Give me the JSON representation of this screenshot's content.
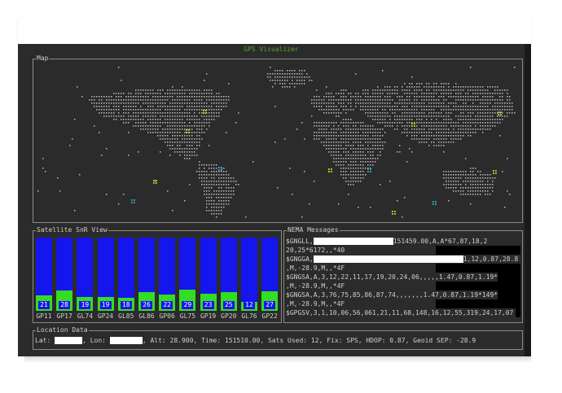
{
  "app": {
    "title": "GPS Visualizer"
  },
  "colors": {
    "accent": "#5aa02c",
    "bar_background": "#1515ee",
    "bar_signal": "#33dd22",
    "map_dot": "#bdbdbd",
    "sat_yellow": "#d6d62a",
    "sat_cyan": "#2ab8c8"
  },
  "map": {
    "title": "Map"
  },
  "snr": {
    "title": "Satellite SnR View",
    "satellites": [
      {
        "id": "GP11",
        "snr": 21
      },
      {
        "id": "GP17",
        "snr": 28
      },
      {
        "id": "GL74",
        "snr": 19
      },
      {
        "id": "GP24",
        "snr": 19
      },
      {
        "id": "GL85",
        "snr": 18
      },
      {
        "id": "GL86",
        "snr": 26
      },
      {
        "id": "GP06",
        "snr": 22
      },
      {
        "id": "GL75",
        "snr": 29
      },
      {
        "id": "GP19",
        "snr": 23
      },
      {
        "id": "GP20",
        "snr": 25
      },
      {
        "id": "GL76",
        "snr": 12
      },
      {
        "id": "GP22",
        "snr": 27
      }
    ]
  },
  "nmea": {
    "title": "NEMA Messages",
    "lines": [
      {
        "pre": "$GNGLL,",
        "post": "151459.00,A,A*67,87,18,2"
      },
      {
        "pre": "20,25*6172,,*40",
        "post": ""
      },
      {
        "pre": "$GNGGA,",
        "post": "1,12,0.87,28.8"
      },
      {
        "pre": ",M,-28.9,M,,*4F",
        "post": ""
      },
      {
        "pre": "$GNGSA,A,3,12,22,11,17,19,20,24,06,,,,,1.47,0.87,1.19*17.8",
        "post": ""
      },
      {
        "pre": ",M,-28.9,M,,*4F",
        "post": ""
      },
      {
        "pre": "$GNGSA,A,3,76,75,85,86,87,74,,,,,,,1.47,0.87,1.19*149*17.8",
        "post": ""
      },
      {
        "pre": ",M,-28.9,M,,*4F",
        "post": ""
      },
      {
        "pre": "$GPGSV,3,1,10,06,56,061,21,11,68,148,16,12,55,319,24,17,07",
        "post": ""
      }
    ]
  },
  "location": {
    "title": "Location Data",
    "lat_label": "Lat:",
    "lon_label": ", Lon:",
    "rest": ", Alt: 28.900, Time: 151510.00, Sats Used: 12, Fix: SPS, HDOP: 0.87, Geoid SEP: -28.9"
  }
}
